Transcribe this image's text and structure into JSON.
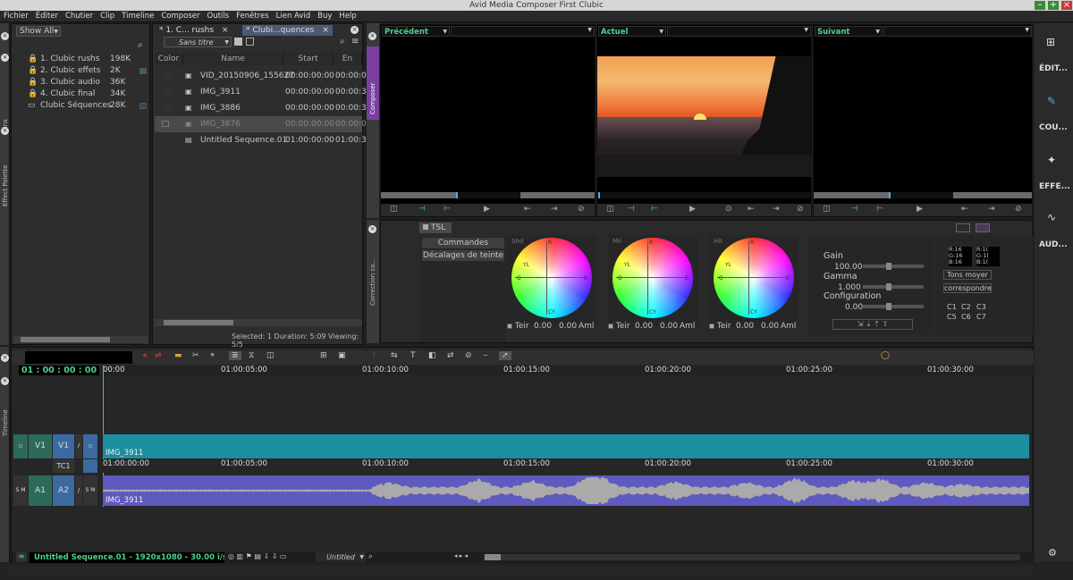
{
  "window": {
    "title": "Avid Media Composer First  Clubic"
  },
  "menu": [
    "Fichier",
    "Éditer",
    "Chutier",
    "Clip",
    "Timeline",
    "Composer",
    "Outils",
    "Fenêtres",
    "Lien Avid",
    "Buy",
    "Help"
  ],
  "bins": {
    "filter": "Show All",
    "side_label": "Bins",
    "effect_label": "Effect Palette",
    "items": [
      {
        "name": "1. Clubic rushs",
        "size": "198K"
      },
      {
        "name": "2. Clubic effets",
        "size": "2K"
      },
      {
        "name": "3. Clubic audio",
        "size": "36K"
      },
      {
        "name": "4. Clubic final",
        "size": "34K"
      },
      {
        "name": "Clubic Séquences",
        "size": "28K"
      }
    ]
  },
  "bin_window": {
    "tab1": "* 1. C... rushs",
    "tab2": "* Clubi...quences",
    "view": "Sans titre",
    "columns": [
      "Color",
      "Name",
      "Start",
      "En"
    ],
    "rows": [
      {
        "name": "VID_20150906_155627",
        "start": "00:00:00:00",
        "end": "00:00:0"
      },
      {
        "name": "IMG_3911",
        "start": "00:00:00:00",
        "end": "00:00:3"
      },
      {
        "name": "IMG_3886",
        "start": "00:00:00:00",
        "end": "00:00:3"
      },
      {
        "name": "IMG_3876",
        "start": "00:00:00:00",
        "end": "00:00:0"
      },
      {
        "name": "Untitled Sequence.01",
        "start": "01:00:00:00",
        "end": "01:00:3"
      }
    ],
    "status": "Selected: 1  Duration: 5:09  Viewing: 5/5"
  },
  "composer": {
    "side_label": "Composer",
    "prev": "Précédent",
    "current": "Actuel",
    "next": "Suivant"
  },
  "color_correction": {
    "side_label": "Correction co...",
    "tab": "TSL",
    "btn1": "Commandes",
    "btn2": "Décalages de teinte",
    "wheels": [
      {
        "label": "Shd",
        "teir": "Teir",
        "v1": "0.00",
        "v2": "0.00",
        "aml": "Aml"
      },
      {
        "label": "Mil",
        "teir": "Teir",
        "v1": "0.00",
        "v2": "0.00",
        "aml": "Aml"
      },
      {
        "label": "Hlt",
        "teir": "Teir",
        "v1": "0.00",
        "v2": "0.00",
        "aml": "Aml"
      }
    ],
    "gain_label": "Gain",
    "gain": "100.00",
    "gamma_label": "Gamma",
    "gamma": "1.000",
    "config_label": "Configuration",
    "config": "0.00",
    "rgb": [
      "R:16",
      "G:16",
      "B:16"
    ],
    "rgb2": [
      "R:1(",
      "G:1(",
      "B:1("
    ],
    "tons": "Tons moyer",
    "corr": "correspondre",
    "presets": [
      "C1",
      "C2",
      "C3",
      "C5",
      "C6",
      "C7"
    ]
  },
  "timeline": {
    "side_label": "Timeline",
    "timecode": "01 : 00 : 00 : 00",
    "ruler": [
      "00:00",
      "01:00:05:00",
      "01:00:10:00",
      "01:00:15:00",
      "01:00:20:00",
      "01:00:25:00",
      "01:00:30:00"
    ],
    "ruler2": [
      "01:00:00:00",
      "01:00:05:00",
      "01:00:10:00",
      "01:00:15:00",
      "01:00:20:00",
      "01:00:25:00",
      "01:00:30:00"
    ],
    "v_track": "V1",
    "v_track2": "V1",
    "tc": "TC1",
    "a_track": "A1",
    "a_track2": "A2",
    "clip_v": "IMG_3911",
    "clip_a": "IMG_3911",
    "sequence_info": "Untitled Sequence.01 - 1920x1080 - 30.00 i/s",
    "sub": "Untitled"
  },
  "right_tools": [
    "ÉDIT...",
    "COU...",
    "EFFE...",
    "AUD..."
  ]
}
